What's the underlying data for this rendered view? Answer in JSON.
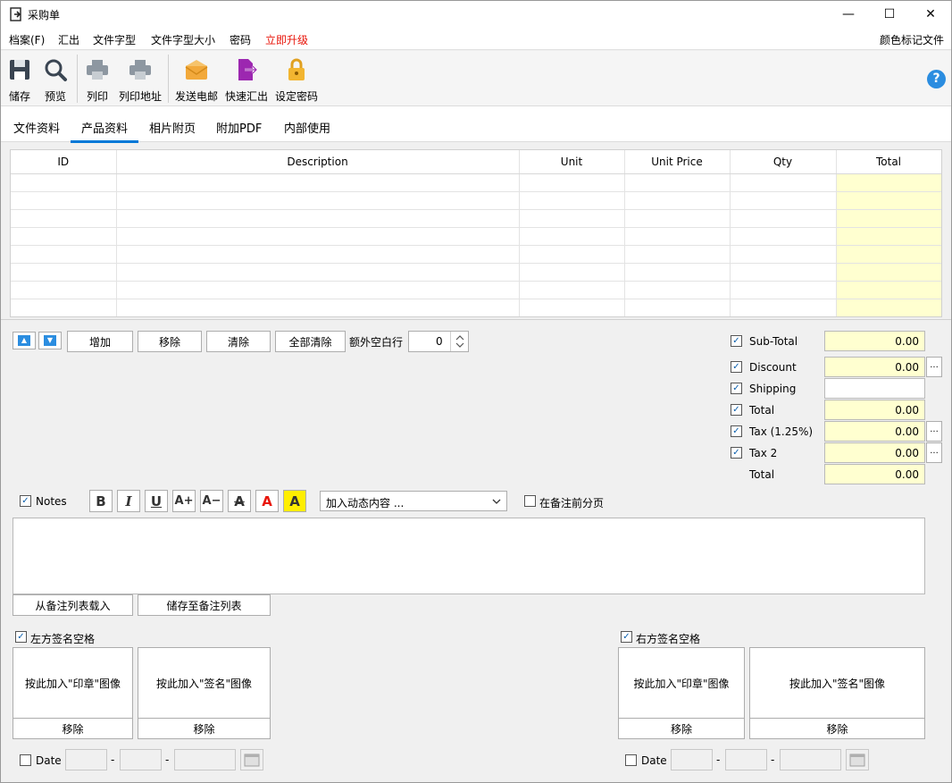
{
  "window": {
    "title": "采购单",
    "minimize": "—",
    "maximize": "☐",
    "close": "✕"
  },
  "menu": {
    "file": "档案(F)",
    "export": "汇出",
    "font": "文件字型",
    "font_size": "文件字型大小",
    "password": "密码",
    "upgrade": "立即升级",
    "color_mark": "颜色标记文件"
  },
  "toolbar": {
    "save": "储存",
    "preview": "预览",
    "print": "列印",
    "print_address": "列印地址",
    "send_email": "发送电邮",
    "quick_export": "快速汇出",
    "set_password": "设定密码",
    "help": "?"
  },
  "tabs": [
    "文件资料",
    "产品资料",
    "相片附页",
    "附加PDF",
    "内部使用"
  ],
  "grid": {
    "columns": [
      "ID",
      "Description",
      "Unit",
      "Unit Price",
      "Qty",
      "Total"
    ],
    "row_count": 8
  },
  "actions": {
    "add": "增加",
    "remove": "移除",
    "clear": "清除",
    "clear_all": "全部清除",
    "extra_rows_label": "额外空白行",
    "extra_rows_value": "0"
  },
  "totals": {
    "subtotal_label": "Sub-Total",
    "subtotal_value": "0.00",
    "discount_label": "Discount",
    "discount_value": "0.00",
    "shipping_label": "Shipping",
    "shipping_value": "",
    "total_label": "Total",
    "total_value": "0.00",
    "tax_label": "Tax (1.25%)",
    "tax_value": "0.00",
    "tax2_label": "Tax 2",
    "tax2_value": "0.00",
    "grand_total_label": "Total",
    "grand_total_value": "0.00",
    "dots": "..."
  },
  "notes": {
    "label": "Notes",
    "dynamic_placeholder": "加入动态内容 ...",
    "page_break_label": "在备注前分页",
    "load_button": "从备注列表载入",
    "save_button": "储存至备注列表",
    "format": {
      "bold": "B",
      "italic": "I",
      "underline": "U",
      "increase": "A+",
      "decrease": "A−",
      "strike": "A",
      "color": "A",
      "highlight": "A"
    }
  },
  "signatures": {
    "left_label": "左方签名空格",
    "right_label": "右方签名空格",
    "stamp": "按此加入\"印章\"图像",
    "sign": "按此加入\"签名\"图像",
    "remove": "移除",
    "date_label": "Date",
    "dash": "-"
  }
}
